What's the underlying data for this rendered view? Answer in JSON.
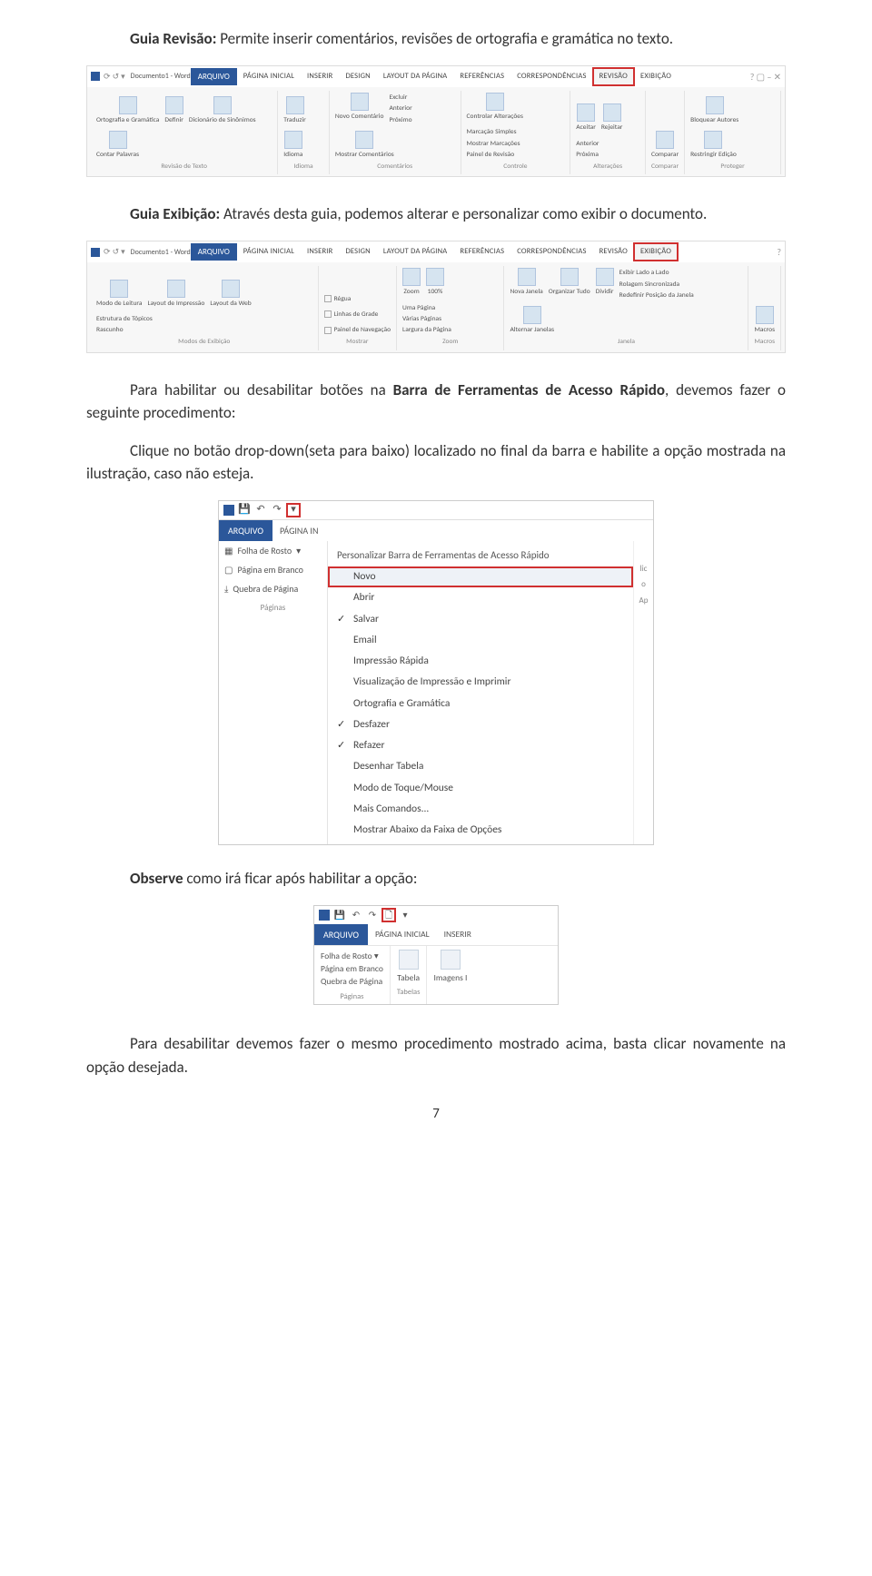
{
  "para1": {
    "lead": "Guia Revisão:",
    "rest": " Permite inserir comentários, revisões de ortografia e gramática no texto."
  },
  "ribbon1": {
    "doctitle": "Documento1 - Word",
    "filetab": "ARQUIVO",
    "tabs": [
      "PÁGINA INICIAL",
      "INSERIR",
      "DESIGN",
      "LAYOUT DA PÁGINA",
      "REFERÊNCIAS",
      "CORRESPONDÊNCIAS"
    ],
    "active_tab": "REVISÃO",
    "after_tabs": [
      "EXIBIÇÃO"
    ],
    "groups": {
      "revisao": {
        "label": "Revisão de Texto",
        "btns": [
          "Ortografia e Gramática",
          "Definir",
          "Dicionário de Sinônimos",
          "Contar Palavras"
        ]
      },
      "idioma": {
        "label": "Idioma",
        "btns": [
          "Traduzir",
          "Idioma"
        ]
      },
      "comentarios": {
        "label": "Comentários",
        "btns": [
          "Novo Comentário",
          "Excluir",
          "Anterior",
          "Próximo",
          "Mostrar Comentários"
        ]
      },
      "controle": {
        "label": "Controle",
        "btns": [
          "Controlar Alterações",
          "Marcação Simples",
          "Mostrar Marcações",
          "Painel de Revisão"
        ]
      },
      "alteracoes": {
        "label": "Alterações",
        "btns": [
          "Aceitar",
          "Rejeitar",
          "Anterior",
          "Próxima"
        ]
      },
      "comparar": {
        "label": "Comparar",
        "btns": [
          "Comparar"
        ]
      },
      "proteger": {
        "label": "Proteger",
        "btns": [
          "Bloquear Autores",
          "Restringir Edição"
        ]
      }
    }
  },
  "para2": {
    "lead": "Guia Exibição:",
    "rest": " Através desta guia, podemos alterar e personalizar como exibir o documento."
  },
  "ribbon2": {
    "doctitle": "Documento1 - Word",
    "filetab": "ARQUIVO",
    "tabs": [
      "PÁGINA INICIAL",
      "INSERIR",
      "DESIGN",
      "LAYOUT DA PÁGINA",
      "REFERÊNCIAS",
      "CORRESPONDÊNCIAS",
      "REVISÃO"
    ],
    "active_tab": "EXIBIÇÃO",
    "groups": {
      "modos": {
        "label": "Modos de Exibição",
        "btns": [
          "Modo de Leitura",
          "Layout de Impressão",
          "Layout da Web",
          "Estrutura de Tópicos",
          "Rascunho"
        ]
      },
      "mostrar": {
        "label": "Mostrar",
        "checks": [
          "Régua",
          "Linhas de Grade",
          "Painel de Navegação"
        ]
      },
      "zoom": {
        "label": "Zoom",
        "btns": [
          "Zoom",
          "100%"
        ],
        "extra": [
          "Uma Página",
          "Várias Páginas",
          "Largura da Página"
        ]
      },
      "janela": {
        "label": "Janela",
        "btns": [
          "Nova Janela",
          "Organizar Tudo",
          "Dividir"
        ],
        "extra": [
          "Exibir Lado a Lado",
          "Rolagem Sincronizada",
          "Redefinir Posição da Janela",
          "Alternar Janelas"
        ]
      },
      "macros": {
        "label": "Macros",
        "btns": [
          "Macros"
        ]
      }
    }
  },
  "para3_a": "Para habilitar ou desabilitar botões na ",
  "para3_b": "Barra de Ferramentas de Acesso Rápido",
  "para3_c": ", devemos fazer o seguinte procedimento:",
  "para4": "Clique no botão drop-down(seta para baixo) localizado no final da barra e habilite a opção mostrada na ilustração, caso não esteja.",
  "qat": {
    "filetab": "ARQUIVO",
    "tab2": "PÁGINA IN",
    "left": {
      "rows": [
        "Folha de Rosto",
        "Página em Branco",
        "Quebra de Página"
      ],
      "section": "Páginas"
    },
    "title": "Personalizar Barra de Ferramentas de Acesso Rápido",
    "items": [
      {
        "label": "Novo",
        "hl": true
      },
      {
        "label": "Abrir"
      },
      {
        "label": "Salvar",
        "chk": true
      },
      {
        "label": "Email"
      },
      {
        "label": "Impressão Rápida"
      },
      {
        "label": "Visualização de Impressão e Imprimir"
      },
      {
        "label": "Ortografia e Gramática"
      },
      {
        "label": "Desfazer",
        "chk": true
      },
      {
        "label": "Refazer",
        "chk": true
      },
      {
        "label": "Desenhar Tabela"
      },
      {
        "label": "Modo de Toque/Mouse"
      },
      {
        "label": "Mais Comandos..."
      },
      {
        "label": "Mostrar Abaixo da Faixa de Opções"
      }
    ],
    "rightletters": [
      "lic",
      "o",
      "Ap"
    ]
  },
  "para5_lead": "Observe",
  "para5_rest": " como irá ficar após habilitar a opção:",
  "mini": {
    "filetab": "ARQUIVO",
    "tabs": [
      "PÁGINA INICIAL",
      "INSERIR"
    ],
    "left": {
      "rows": [
        "Folha de Rosto",
        "Página em Branco",
        "Quebra de Página"
      ],
      "section": "Páginas"
    },
    "cols": [
      {
        "name": "Tabela",
        "section": "Tabelas"
      },
      {
        "name": "Imagens I"
      }
    ]
  },
  "para6": "Para desabilitar devemos fazer o mesmo procedimento mostrado acima, basta clicar novamente na opção desejada.",
  "pagenum": "7"
}
